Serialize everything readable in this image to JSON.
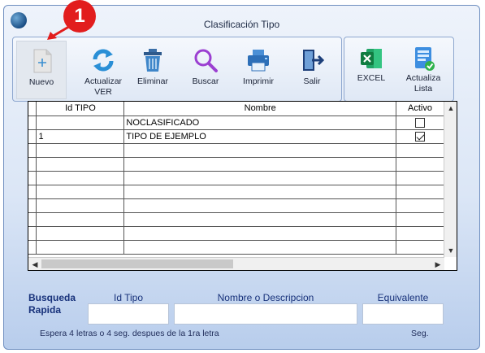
{
  "window": {
    "title": "Clasificación Tipo"
  },
  "badge": {
    "number": "1"
  },
  "toolbar": {
    "nuevo": "Nuevo",
    "actualizar_ver": "Actualizar VER",
    "eliminar": "Eliminar",
    "buscar": "Buscar",
    "imprimir": "Imprimir",
    "salir": "Salir",
    "excel": "EXCEL",
    "actualiza_lista": "Actualiza Lista"
  },
  "grid": {
    "headers": {
      "id": "Id TIPO",
      "nombre": "Nombre",
      "activo": "Activo"
    },
    "rows": [
      {
        "id": "",
        "nombre": "NOCLASIFICADO",
        "activo": false
      },
      {
        "id": "1",
        "nombre": "TIPO DE EJEMPLO",
        "activo": true
      },
      {
        "id": "",
        "nombre": "",
        "activo": null
      },
      {
        "id": "",
        "nombre": "",
        "activo": null
      },
      {
        "id": "",
        "nombre": "",
        "activo": null
      },
      {
        "id": "",
        "nombre": "",
        "activo": null
      },
      {
        "id": "",
        "nombre": "",
        "activo": null
      },
      {
        "id": "",
        "nombre": "",
        "activo": null
      },
      {
        "id": "",
        "nombre": "",
        "activo": null
      },
      {
        "id": "",
        "nombre": "",
        "activo": null
      }
    ]
  },
  "quick_search": {
    "label_line1": "Busqueda",
    "label_line2": "Rapida",
    "col_id": "Id Tipo",
    "col_nombre": "Nombre o Descripcion",
    "col_equivalente": "Equivalente",
    "id_value": "",
    "nombre_value": "",
    "equivalente_value": "",
    "hint": "Espera 4 letras o 4 seg. despues de la 1ra letra",
    "seg_label": "Seg."
  },
  "colors": {
    "accent_title": "#17317a",
    "badge_red": "#e21d1d"
  }
}
